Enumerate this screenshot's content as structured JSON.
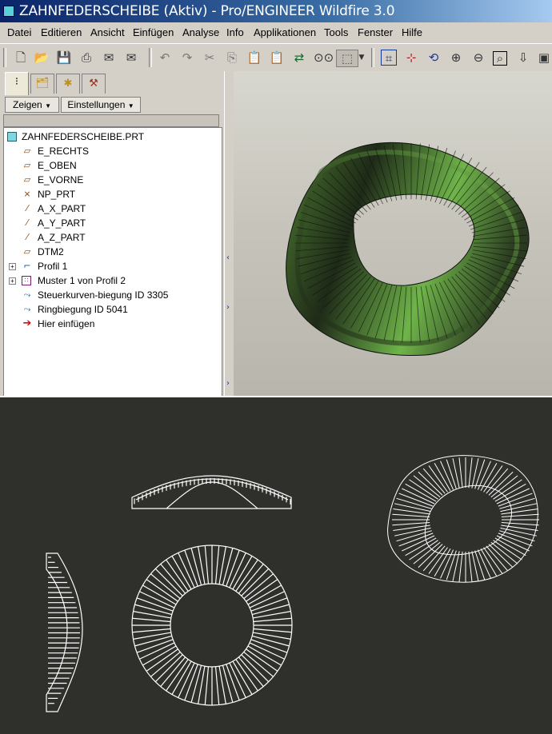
{
  "window": {
    "title": "ZAHNFEDERSCHEIBE (Aktiv) - Pro/ENGINEER Wildfire 3.0",
    "accent_color": "#0a246a"
  },
  "menu": {
    "items": [
      "Datei",
      "Editieren",
      "Ansicht",
      "Einfügen",
      "Analyse",
      "Info",
      "Applikationen",
      "Tools",
      "Fenster",
      "Hilfe"
    ]
  },
  "toolbar": {
    "icons": [
      "new-file-icon",
      "open-folder-icon",
      "save-icon",
      "print-icon",
      "send-mail-icon",
      "mail-attachment-icon",
      "undo-icon",
      "redo-icon",
      "cut-icon",
      "copy-icon",
      "paste-icon",
      "paste-special-icon",
      "regenerate-icon",
      "find-icon",
      "select-box-icon",
      "orient-icon",
      "spin-center-icon",
      "saved-views-icon",
      "zoom-in-icon",
      "zoom-out-icon",
      "refit-icon",
      "reorient-icon",
      "view-manager-icon"
    ]
  },
  "navigator": {
    "tabs": [
      "model-tree-tab",
      "folder-browser-tab",
      "favorites-tab",
      "connections-tab"
    ],
    "show_label": "Zeigen",
    "settings_label": "Einstellungen"
  },
  "model_tree": {
    "root": "ZAHNFEDERSCHEIBE.PRT",
    "items": [
      {
        "label": "E_RECHTS",
        "icon": "datum-plane-icon",
        "expandable": false
      },
      {
        "label": "E_OBEN",
        "icon": "datum-plane-icon",
        "expandable": false
      },
      {
        "label": "E_VORNE",
        "icon": "datum-plane-icon",
        "expandable": false
      },
      {
        "label": "NP_PRT",
        "icon": "coordinate-system-icon",
        "expandable": false
      },
      {
        "label": "A_X_PART",
        "icon": "datum-axis-icon",
        "expandable": false
      },
      {
        "label": "A_Y_PART",
        "icon": "datum-axis-icon",
        "expandable": false
      },
      {
        "label": "A_Z_PART",
        "icon": "datum-axis-icon",
        "expandable": false
      },
      {
        "label": "DTM2",
        "icon": "datum-plane-icon",
        "expandable": false
      },
      {
        "label": "Profil 1",
        "icon": "profile-feature-icon",
        "expandable": true
      },
      {
        "label": "Muster 1 von Profil 2",
        "icon": "pattern-icon",
        "expandable": true
      },
      {
        "label": "Steuerkurven-biegung ID 3305",
        "icon": "bend-feature-icon",
        "expandable": false
      },
      {
        "label": "Ringbiegung ID 5041",
        "icon": "bend-feature-icon",
        "expandable": false
      },
      {
        "label": "Hier einfügen",
        "icon": "insert-here-arrow-icon",
        "expandable": false
      }
    ]
  },
  "colors": {
    "model_green": "#6fb44a",
    "model_dark": "#1e2a18",
    "viewport_bg": "#c8c6bd",
    "drawing_bg": "#2f2f2c",
    "drawing_line": "#ffffff"
  }
}
